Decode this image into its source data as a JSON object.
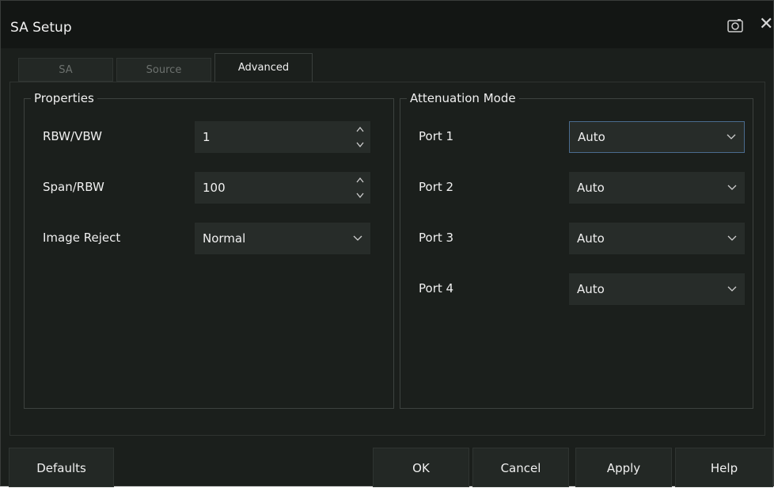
{
  "window": {
    "title": "SA Setup"
  },
  "tabs": [
    {
      "label": "SA"
    },
    {
      "label": "Source"
    },
    {
      "label": "Advanced"
    }
  ],
  "properties": {
    "title": "Properties",
    "rbw_vbw": {
      "label": "RBW/VBW",
      "value": "1"
    },
    "span_rbw": {
      "label": "Span/RBW",
      "value": "100"
    },
    "image_reject": {
      "label": "Image Reject",
      "value": "Normal"
    }
  },
  "attenuation": {
    "title": "Attenuation Mode",
    "ports": [
      {
        "label": "Port 1",
        "value": "Auto"
      },
      {
        "label": "Port 2",
        "value": "Auto"
      },
      {
        "label": "Port 3",
        "value": "Auto"
      },
      {
        "label": "Port 4",
        "value": "Auto"
      }
    ]
  },
  "buttons": {
    "defaults": "Defaults",
    "ok": "OK",
    "cancel": "Cancel",
    "apply": "Apply",
    "help": "Help"
  }
}
